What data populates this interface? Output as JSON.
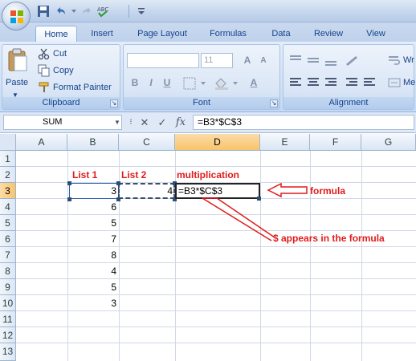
{
  "quick_access": {
    "icons": [
      "save-icon",
      "undo-icon",
      "redo-icon",
      "spellcheck-icon",
      "customize-icon"
    ]
  },
  "tabs": [
    {
      "label": "Home",
      "active": true
    },
    {
      "label": "Insert",
      "active": false
    },
    {
      "label": "Page Layout",
      "active": false
    },
    {
      "label": "Formulas",
      "active": false
    },
    {
      "label": "Data",
      "active": false
    },
    {
      "label": "Review",
      "active": false
    },
    {
      "label": "View",
      "active": false
    }
  ],
  "ribbon": {
    "clipboard": {
      "paste_label": "Paste",
      "cut_label": "Cut",
      "copy_label": "Copy",
      "format_painter_label": "Format Painter",
      "group_label": "Clipboard"
    },
    "font": {
      "font_size": "11",
      "bold": "B",
      "italic": "I",
      "underline": "U",
      "grow": "A",
      "shrink": "A",
      "color_a": "A",
      "group_label": "Font"
    },
    "alignment": {
      "wrap_label": "Wr",
      "merge_label": "Me",
      "group_label": "Alignment"
    }
  },
  "formula_bar": {
    "name_box": "SUM",
    "cancel": "✕",
    "enter": "✓",
    "fx": "fx",
    "formula": "=B3*$C$3"
  },
  "sheet": {
    "columns": [
      "A",
      "B",
      "C",
      "D",
      "E",
      "F",
      "G"
    ],
    "rows": [
      "1",
      "2",
      "3",
      "4",
      "5",
      "6",
      "7",
      "8",
      "9",
      "10",
      "11",
      "12",
      "13"
    ],
    "selected_column": "D",
    "selected_row": "3",
    "headers": {
      "list1": "List 1",
      "list2": "List 2",
      "multiplication": "multiplication"
    },
    "list1_values": [
      "3",
      "6",
      "5",
      "7",
      "8",
      "4",
      "5",
      "3"
    ],
    "c3_value": "4",
    "d3_editing": "=B3*$C$3"
  },
  "annotations": {
    "formula_label": "formula",
    "dollar_label": "$ appears in the formula"
  },
  "colors": {
    "annotation_red": "#e01b1b",
    "selected_header": "#f8c46b",
    "ribbon_blue": "#15428b"
  }
}
